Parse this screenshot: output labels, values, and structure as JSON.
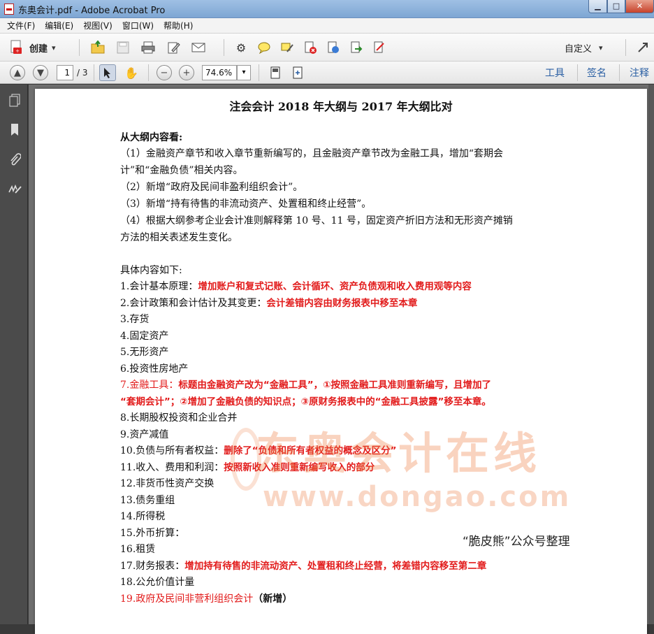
{
  "window": {
    "title": "东奥会计.pdf - Adobe Acrobat Pro",
    "controls": {
      "minimize": "▁",
      "maximize": "□",
      "close": "✕"
    }
  },
  "menu": [
    "文件(F)",
    "编辑(E)",
    "视图(V)",
    "窗口(W)",
    "帮助(H)"
  ],
  "toolbar": {
    "create_label": "创建",
    "create_arrow": "▾",
    "custom_label": "自定义",
    "custom_arrow": "▾",
    "icons": [
      "open-folder-icon",
      "save-icon",
      "print-icon",
      "edit-icon",
      "email-icon",
      "settings-icon",
      "comment-icon",
      "highlight-icon",
      "delete-page-icon",
      "insert-page-icon",
      "export-icon",
      "sign-icon",
      "expand-icon"
    ]
  },
  "navbar": {
    "page_current": "1",
    "page_total": "/ 3",
    "zoom": "74.6%",
    "zoom_arrow": "▾",
    "tabs": [
      "工具",
      "签名",
      "注释"
    ]
  },
  "document": {
    "title": "注会会计 2018 年大纲与 2017 年大纲比对",
    "section_heading": "从大纲内容看:",
    "overview": [
      "（1）金融资产章节和收入章节重新编写的，且金融资产章节改为金融工具，增加“套期会",
      "计”和“金融负债”相关内容。",
      "（2）新增“政府及民间非盈利组织会计”。",
      "（3）新增“持有待售的非流动资产、处置租和终止经营”。",
      "（4）根据大纲参考企业会计准则解释第  10  号、11 号，固定资产折旧方法和无形资产摊销",
      "方法的相关表述发生变化。"
    ],
    "detail_heading": "具体内容如下:",
    "items": [
      {
        "label": "1.会计基本原理：",
        "note": "增加账户和复式记账、会计循环、资产负债观和收入费用观等内容"
      },
      {
        "label": "2.会计政策和会计估计及其变更：",
        "note": "会计差错内容由财务报表中移至本章"
      },
      {
        "label": "3.存货",
        "note": ""
      },
      {
        "label": "4.固定资产",
        "note": ""
      },
      {
        "label": "5.无形资产",
        "note": ""
      },
      {
        "label": "6.投资性房地产",
        "note": ""
      },
      {
        "label": "7.",
        "label_red": "金融工具：",
        "note": "标题由金融资产改为“金融工具”，①按照金融工具准则重新编写，且增加了"
      },
      {
        "label": "",
        "note": "“套期会计”；②增加了金融负债的知识点；③原财务报表中的“金融工具披露”移至本章。"
      },
      {
        "label": "8.长期股权投资和企业合并",
        "note": ""
      },
      {
        "label": "9.资产减值",
        "note": ""
      },
      {
        "label": "10.负债与所有者权益：",
        "note": "删除了“负债和所有者权益的概念及区分”"
      },
      {
        "label": "11.收入、费用和利润：",
        "note": "按照新收入准则重新编写收入的部分"
      },
      {
        "label": "12.非货币性资产交换",
        "note": ""
      },
      {
        "label": "13.债务重组",
        "note": ""
      },
      {
        "label": "14.所得税",
        "note": ""
      },
      {
        "label": "15.外币折算：",
        "note": ""
      },
      {
        "label": "16.租赁",
        "note": ""
      },
      {
        "label": "17.财务报表：",
        "note": "增加持有待售的非流动资产、处置租和终止经营，将差错内容移至第二章"
      },
      {
        "label": "18.公允价值计量",
        "note": ""
      },
      {
        "label": "19.",
        "label_red": "政府及民间非营利组织会计",
        "suffix": "（新增）",
        "note": ""
      }
    ],
    "watermark_cn": "东奥会计在线",
    "watermark_url": "www.dongao.com",
    "credit": "“脆皮熊”公众号整理"
  }
}
